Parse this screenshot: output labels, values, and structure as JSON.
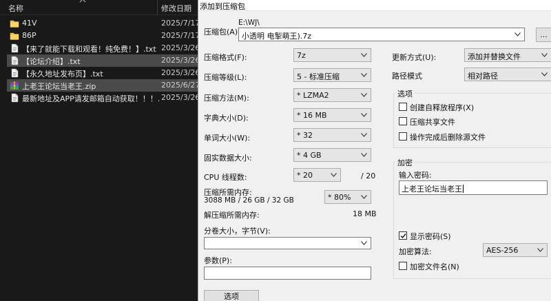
{
  "explorer": {
    "col_name": "名称",
    "col_date": "修改日期",
    "files": [
      {
        "name": "41V",
        "date": "2025/7/17",
        "type": "folder",
        "selected": false
      },
      {
        "name": "86P",
        "date": "2025/7/17",
        "type": "folder",
        "selected": false
      },
      {
        "name": "【来了就能下载和观看！纯免费！】.txt",
        "date": "2025/3/26",
        "type": "txt",
        "selected": false
      },
      {
        "name": "【论坛介绍】.txt",
        "date": "2025/3/26",
        "type": "txt",
        "selected": true
      },
      {
        "name": "【永久地址发布页】.txt",
        "date": "2025/3/26",
        "type": "txt",
        "selected": false
      },
      {
        "name": "上老王论坛当老王.zip",
        "date": "2025/6/27",
        "type": "archive",
        "selected": true
      },
      {
        "name": "最新地址及APP请发邮箱自动获取！！！....",
        "date": "2025/3/26",
        "type": "txt",
        "selected": false
      }
    ]
  },
  "dialog": {
    "title": "添加到压缩包",
    "archive_label": "压缩包(A):",
    "archive_path": "E:\\WJ\\",
    "archive_name": "小透明 电掣萌王).7z",
    "browse_label": "...",
    "format_label": "压缩格式(F):",
    "format_value": "7z",
    "level_label": "压缩等级(L):",
    "level_value": "5 - 标准压缩",
    "method_label": "压缩方法(M):",
    "method_value": "* LZMA2",
    "dict_label": "字典大小(D):",
    "dict_value": "* 16 MB",
    "word_label": "单词大小(W):",
    "word_value": "* 32",
    "solid_label": "固实数据大小:",
    "solid_value": "* 4 GB",
    "cpu_label": "CPU 线程数:",
    "cpu_value": "* 20",
    "cpu_max": "/ 20",
    "mem_compress_label": "压缩所需内存:",
    "mem_compress_detail": "3088 MB / 26 GB / 32 GB",
    "mem_percent": "* 80%",
    "mem_decompress_label": "解压缩所需内存:",
    "mem_decompress_value": "18 MB",
    "split_label": "分卷大小，字节(V):",
    "split_value": "",
    "params_label": "参数(P):",
    "params_value": "",
    "options_button": "选项",
    "update_label": "更新方式(U):",
    "update_value": "添加并替换文件",
    "path_mode_label": "路径模式",
    "path_mode_value": "相对路径",
    "options_group": "选项",
    "opt_sfx": "创建自释放程序(X)",
    "opt_shared": "压缩共享文件",
    "opt_delete": "操作完成后删除源文件",
    "encrypt_group": "加密",
    "password_label": "输入密码:",
    "password_value": "上老王论坛当老王",
    "show_password": "显示密码(S)",
    "encrypt_method_label": "加密算法:",
    "encrypt_method_value": "AES-256",
    "encrypt_names": "加密文件名(N)"
  },
  "colors": {
    "explorer_bg": "#191919",
    "selected_row": "#4a4a4a",
    "dialog_bg": "#f0f0f0",
    "folder_yellow": "#f2c450"
  }
}
